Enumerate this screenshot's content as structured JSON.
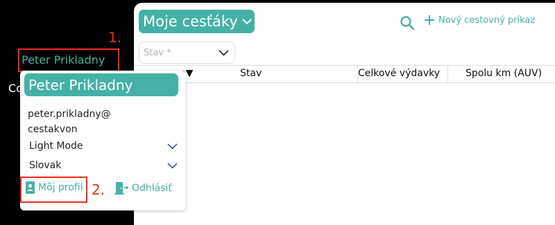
{
  "header": {
    "app_title": "Moje cesťáky",
    "new_button_label": "Nový cestovný príkaz"
  },
  "filter": {
    "status_placeholder": "Stav *"
  },
  "table": {
    "columns": [
      "e▼",
      "Stav",
      "Celkové výdavky",
      "Spolu km (AUV)"
    ]
  },
  "sidebar": {
    "user_name_link": "Peter Prikladny",
    "partial_label": "Co"
  },
  "popup": {
    "name": "Peter Prikladny",
    "email_line1": "peter.prikladny@",
    "email_line2": "cestakvon",
    "theme_label": "Light Mode",
    "language_label": "Slovak",
    "profile_label": "Môj profil",
    "logout_label": "Odhlásiť"
  },
  "annotations": {
    "step1": "1.",
    "step2": "2."
  },
  "colors": {
    "accent": "#45b1a5",
    "annotation": "#f02a1a",
    "chevron_blue": "#2a3fbf"
  }
}
